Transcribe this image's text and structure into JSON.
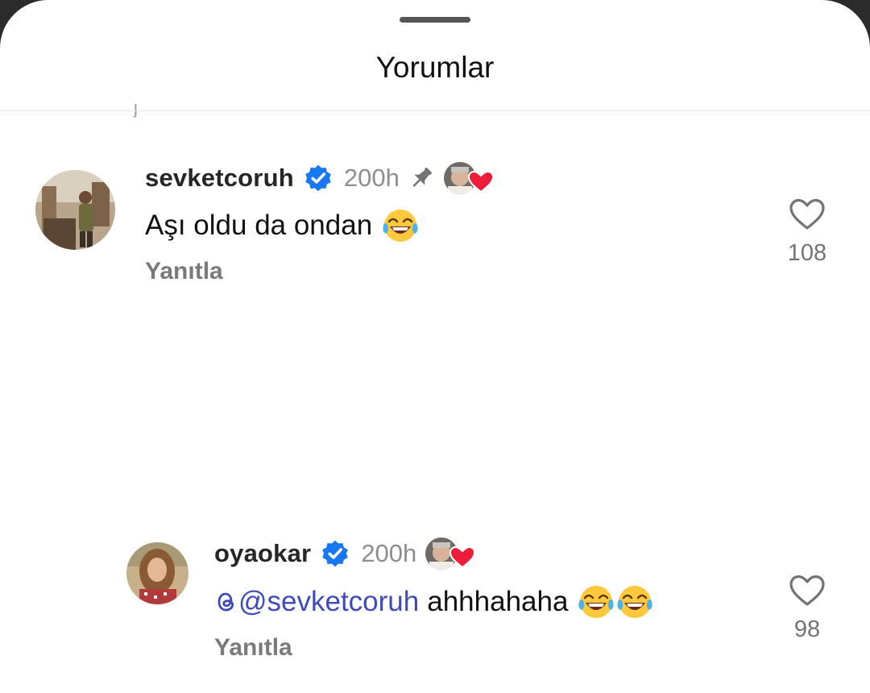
{
  "sheet": {
    "title": "Yorumlar"
  },
  "comments": [
    {
      "username": "sevketcoruh",
      "time": "200h",
      "text": "Aşı oldu da ondan",
      "reply_label": "Yanıtla",
      "like_count": "108",
      "pinned": true,
      "emojis": [
        "face-with-tears-of-joy"
      ]
    },
    {
      "username": "oyaokar",
      "time": "200h",
      "mention": "@sevketcoruh",
      "text": "ahhhahaha",
      "reply_label": "Yanıtla",
      "like_count": "98",
      "pinned": false,
      "emojis": [
        "face-with-tears-of-joy",
        "face-with-tears-of-joy"
      ]
    }
  ],
  "colors": {
    "verified": "#1877F2",
    "heart": "#ED1C3A",
    "mention": "#3F4BBD",
    "secondary_text": "#8E8E8E"
  }
}
